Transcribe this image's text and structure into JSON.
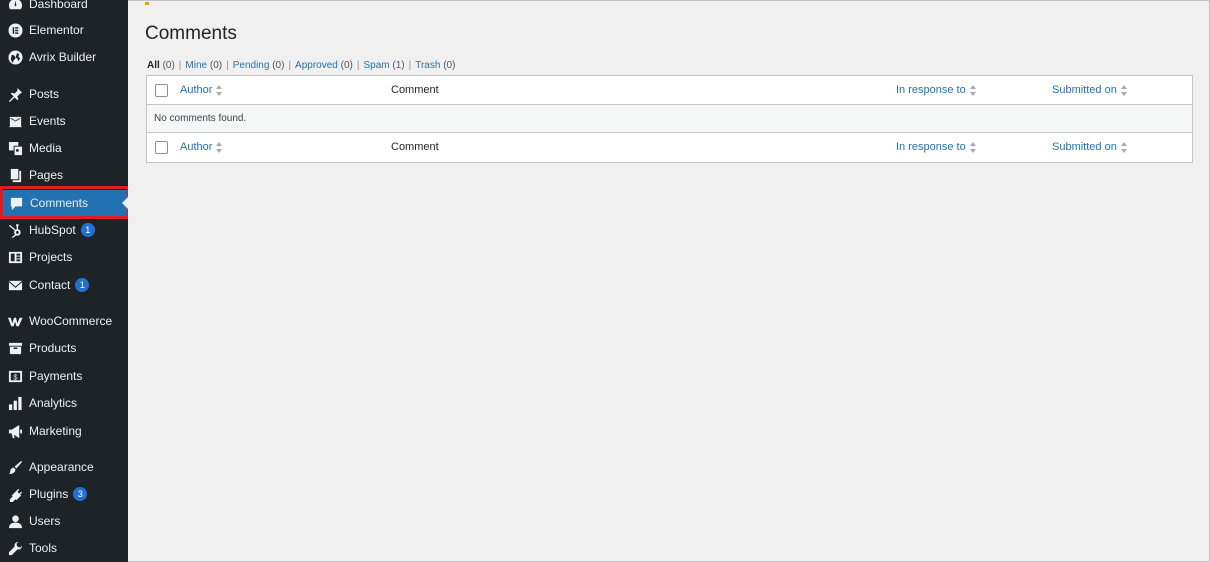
{
  "sidebar": {
    "items": [
      {
        "label": "Dashboard",
        "icon": "dashboard-icon"
      },
      {
        "label": "Elementor",
        "icon": "elementor-icon"
      },
      {
        "label": "Avrix Builder",
        "icon": "globe-icon"
      },
      {
        "label": "Posts",
        "icon": "pin-icon"
      },
      {
        "label": "Events",
        "icon": "events-icon"
      },
      {
        "label": "Media",
        "icon": "media-icon"
      },
      {
        "label": "Pages",
        "icon": "pages-icon"
      },
      {
        "label": "Comments",
        "icon": "comment-bubble-icon",
        "active": true
      },
      {
        "label": "HubSpot",
        "icon": "hubspot-icon",
        "badge": "1"
      },
      {
        "label": "Projects",
        "icon": "portfolio-icon"
      },
      {
        "label": "Contact",
        "icon": "mail-icon",
        "badge": "1"
      },
      {
        "label": "WooCommerce",
        "icon": "woocommerce-icon"
      },
      {
        "label": "Products",
        "icon": "archive-box-icon"
      },
      {
        "label": "Payments",
        "icon": "money-icon"
      },
      {
        "label": "Analytics",
        "icon": "bar-chart-icon"
      },
      {
        "label": "Marketing",
        "icon": "megaphone-icon"
      },
      {
        "label": "Appearance",
        "icon": "paintbrush-icon"
      },
      {
        "label": "Plugins",
        "icon": "plug-icon",
        "badge": "3"
      },
      {
        "label": "Users",
        "icon": "user-icon"
      },
      {
        "label": "Tools",
        "icon": "wrench-icon"
      }
    ]
  },
  "main": {
    "title": "Comments",
    "filters": [
      {
        "label": "All",
        "count": "(0)",
        "current": true
      },
      {
        "label": "Mine",
        "count": "(0)"
      },
      {
        "label": "Pending",
        "count": "(0)"
      },
      {
        "label": "Approved",
        "count": "(0)"
      },
      {
        "label": "Spam",
        "count": "(1)"
      },
      {
        "label": "Trash",
        "count": "(0)"
      }
    ],
    "table": {
      "columns": {
        "author": "Author",
        "comment": "Comment",
        "response": "In response to",
        "submitted": "Submitted on"
      },
      "empty_message": "No comments found."
    }
  },
  "colors": {
    "sidebar_bg": "#1d2327",
    "accent": "#2271b1",
    "highlight_border": "#e01b22",
    "badge": "#2271d1"
  }
}
